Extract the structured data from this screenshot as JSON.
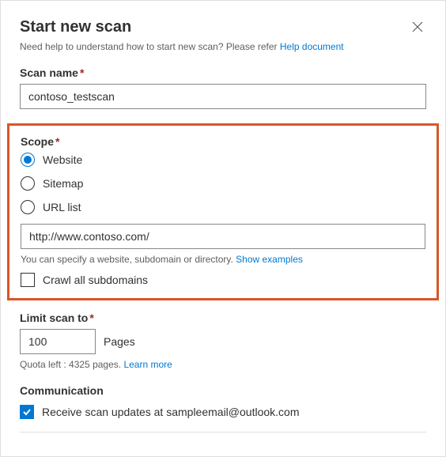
{
  "header": {
    "title": "Start new scan",
    "help_prefix": "Need help to understand how to start new scan? Please refer ",
    "help_link": "Help document"
  },
  "scan_name": {
    "label": "Scan name",
    "value": "contoso_testscan"
  },
  "scope": {
    "label": "Scope",
    "options": {
      "website": "Website",
      "sitemap": "Sitemap",
      "urllist": "URL list"
    },
    "selected": "website",
    "url_value": "http://www.contoso.com/",
    "hint_prefix": "You can specify a website, subdomain or directory. ",
    "hint_link": "Show examples",
    "crawl_label": "Crawl all subdomains",
    "crawl_checked": false
  },
  "limit": {
    "label": "Limit scan to",
    "value": "100",
    "unit": "Pages",
    "quota_prefix": "Quota left : 4325 pages. ",
    "quota_link": "Learn more"
  },
  "communication": {
    "label": "Communication",
    "receive_label": "Receive scan updates at sampleemail@outlook.com",
    "receive_checked": true
  }
}
